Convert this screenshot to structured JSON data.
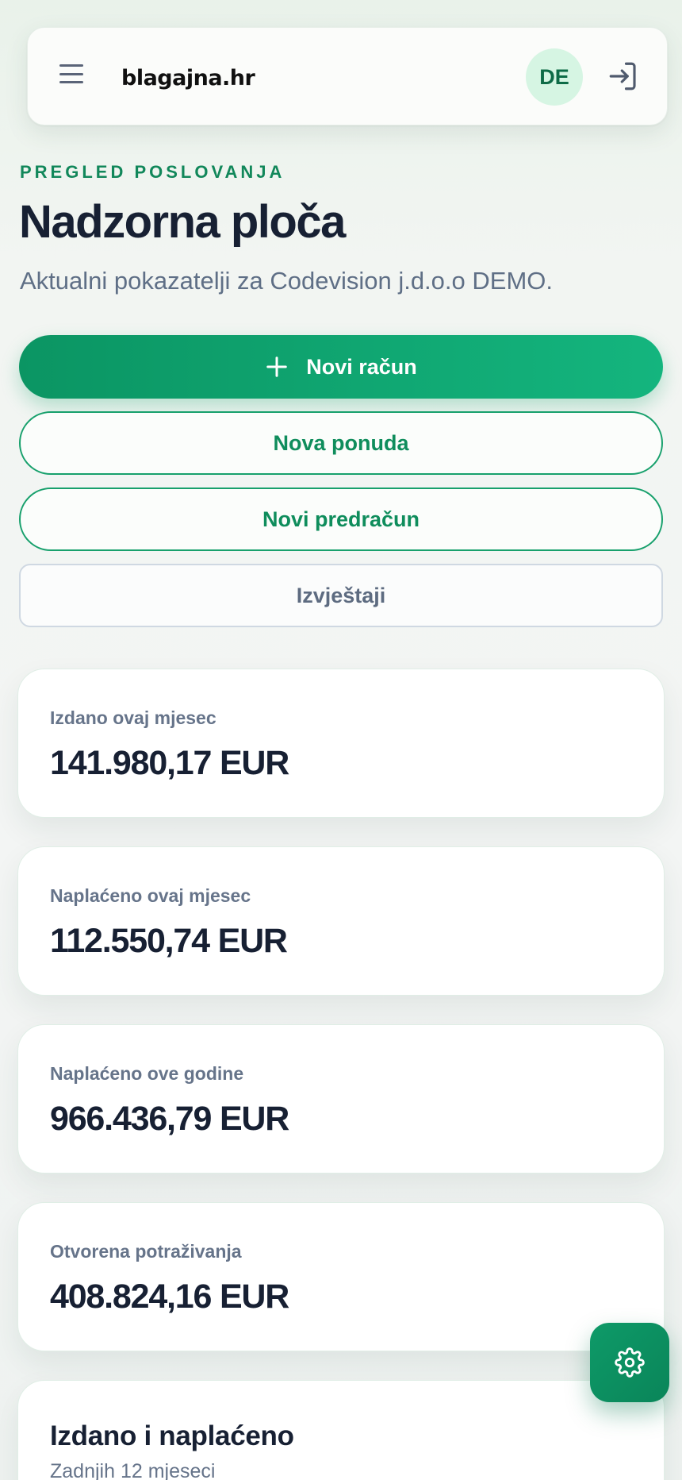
{
  "header": {
    "logo_text": "blagajna.hr",
    "avatar_initials": "DE",
    "menu_icon": "hamburger-menu-icon",
    "login_icon": "sign-in-icon"
  },
  "page": {
    "eyebrow": "PREGLED POSLOVANJA",
    "title": "Nadzorna ploča",
    "subtitle": "Aktualni pokazatelji za Codevision j.d.o.o DEMO."
  },
  "actions": {
    "new_invoice": "Novi račun",
    "new_offer": "Nova ponuda",
    "new_proforma": "Novi predračun",
    "reports": "Izvještaji"
  },
  "stats": [
    {
      "label": "Izdano ovaj mjesec",
      "value": "141.980,17 EUR"
    },
    {
      "label": "Naplaćeno ovaj mjesec",
      "value": "112.550,74 EUR"
    },
    {
      "label": "Naplaćeno ove godine",
      "value": "966.436,79 EUR"
    },
    {
      "label": "Otvorena potraživanja",
      "value": "408.824,16 EUR"
    }
  ],
  "chart_section": {
    "title": "Izdano i naplaćeno",
    "subtitle": "Zadnjih 12 mjeseci"
  },
  "fab": {
    "icon": "settings-gear-icon"
  },
  "colors": {
    "accent": "#11875a",
    "primary_gradient_start": "#0b9563",
    "primary_gradient_end": "#14b57e",
    "avatar_bg": "#d6f5e3",
    "heading": "#172033",
    "muted": "#66748a"
  }
}
